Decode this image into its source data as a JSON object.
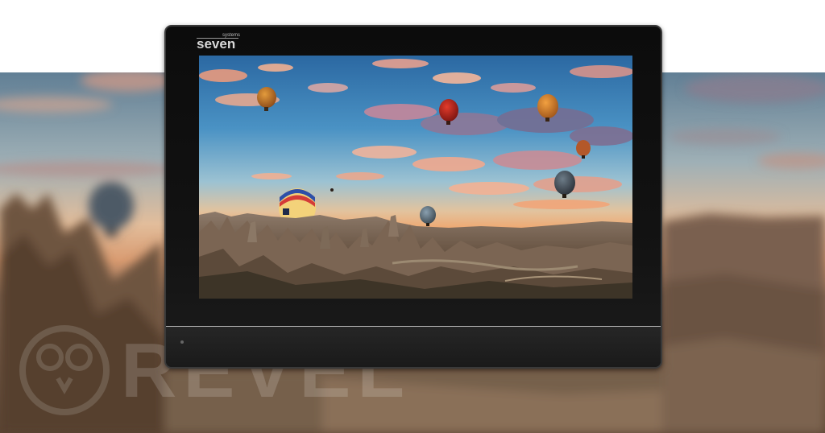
{
  "device": {
    "brand_name": "seven",
    "brand_sub": "systems"
  },
  "watermark": {
    "text": "REVEL"
  },
  "scene": {
    "subject": "hot-air-balloons-cappadocia",
    "sky_colors": [
      "#2f6fa3",
      "#4b8fc0",
      "#9fc3d6",
      "#e9b98e",
      "#e89a6a"
    ],
    "ground_colors": [
      "#5a4a3c",
      "#7b634f",
      "#3f3a2e"
    ]
  }
}
